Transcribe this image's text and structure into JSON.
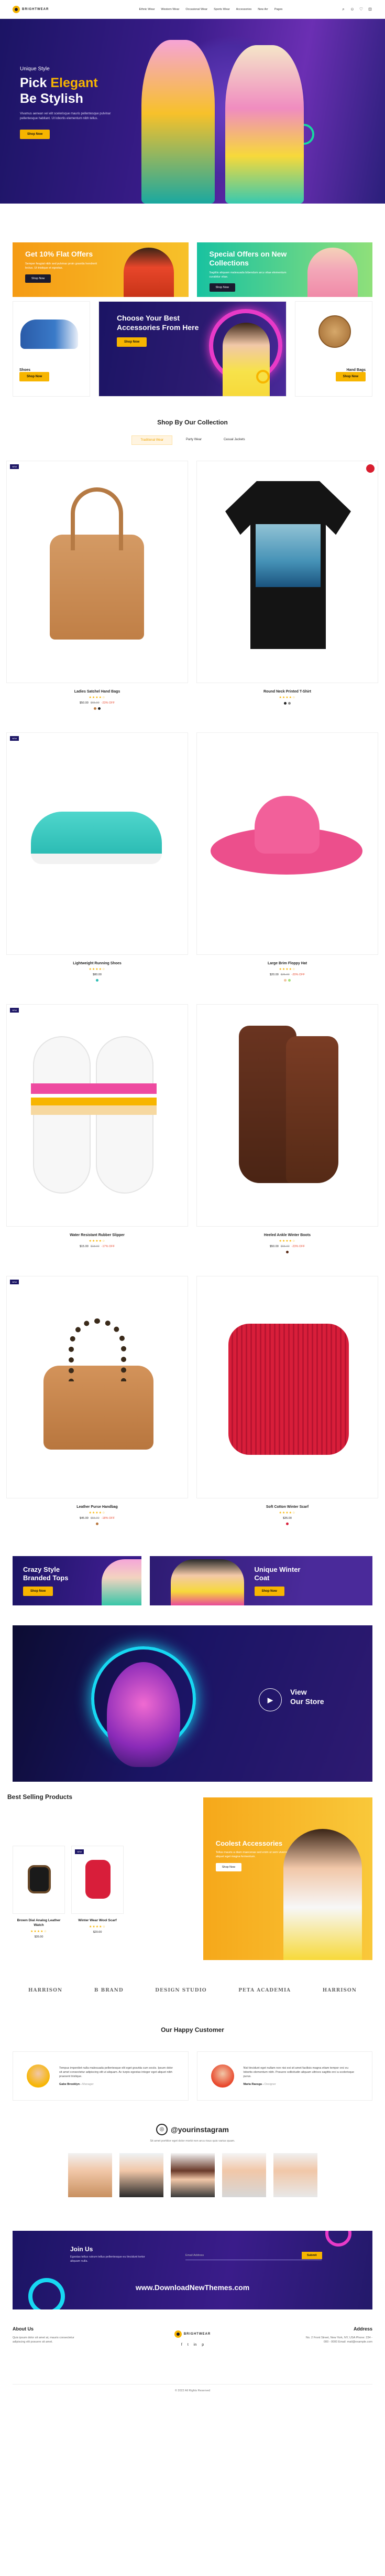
{
  "brand": {
    "name": "BRIGHTWEAR"
  },
  "nav": [
    "Ethnic Wear",
    "Western Wear",
    "Occasional Wear",
    "Sports Wear",
    "Accessories",
    "New Arr",
    "Pages"
  ],
  "hero": {
    "subtitle": "Unique Style",
    "title_line1_a": "Pick ",
    "title_line1_b": "Elegant",
    "title_line2": "Be Stylish",
    "desc": "Vivamus aenean vel elit scelerisque mauris pellentesque pulvinar pellentesque habitant. Ut lobortis elementum nibh tellus.",
    "button": "Shop Now"
  },
  "offers": [
    {
      "title": "Get 10% Flat Offers",
      "desc": "Semper feugiat nibh sed pulvinar proin gravida hendrerit lectus. Ut tristique et egestas.",
      "button": "Shop Now"
    },
    {
      "title": "Special Offers on New Collections",
      "desc": "Sagittis aliquam malesuada bibendum arcu vitae elementum curabitur vitae.",
      "button": "Shop Now"
    }
  ],
  "accessories": {
    "left": {
      "name": "Shoes",
      "button": "Shop Now"
    },
    "center": {
      "title": "Choose Your Best Accessories From Here",
      "button": "Shop Now"
    },
    "right": {
      "name": "Hand Bags",
      "button": "Shop Now"
    }
  },
  "collection": {
    "title": "Shop By Our Collection",
    "tabs": [
      "Traditional Wear",
      "Party Wear",
      "Casual Jackets"
    ]
  },
  "products": [
    {
      "name": "Ladies Satchel Hand Bags",
      "stars": "★★★★☆",
      "price": "$50.00",
      "old": "$65.00",
      "off": "-23% OFF",
      "badge": "NEW"
    },
    {
      "name": "Round Neck Printed T-Shirt",
      "stars": "★★★★☆",
      "price": "",
      "old": "",
      "off": "",
      "badge": ""
    },
    {
      "name": "Lightweight Running Shoes",
      "stars": "★★★★☆",
      "price": "$80.00",
      "old": "",
      "off": "",
      "badge": "NEW"
    },
    {
      "name": "Large Brim Floppy Hat",
      "stars": "★★★★☆",
      "price": "$20.00",
      "old": "$25.00",
      "off": "-20% OFF",
      "badge": ""
    },
    {
      "name": "Water Resistant Rubber Slipper",
      "stars": "★★★★☆",
      "price": "$15.00",
      "old": "$18.00",
      "off": "-17% OFF",
      "badge": "NEW"
    },
    {
      "name": "Heeled Ankle Winter Boots",
      "stars": "★★★★☆",
      "price": "$50.00",
      "old": "$65.00",
      "off": "-23% OFF",
      "badge": ""
    },
    {
      "name": "Leather Purse Handbag",
      "stars": "★★★★☆",
      "price": "$45.00",
      "old": "$55.00",
      "off": "-18% OFF",
      "badge": "NEW"
    },
    {
      "name": "Soft Cotton Winter Scarf",
      "stars": "★★★★☆",
      "price": "$35.00",
      "old": "",
      "off": "",
      "badge": ""
    }
  ],
  "promos": [
    {
      "title": "Crazy Style Branded Tops",
      "button": "Shop Now"
    },
    {
      "title": "Unique Winter Coat",
      "button": "Shop Now"
    }
  ],
  "video": {
    "text_line1": "View",
    "text_line2": "Our Store"
  },
  "best": {
    "title": "Best Selling Products",
    "items": [
      {
        "name": "Brown Dial Analog Leather Watch",
        "stars": "★★★★☆",
        "price": "$35.00"
      },
      {
        "name": "Winter Wear Wool Scarf",
        "stars": "★★★★☆",
        "price": "$20.00"
      }
    ],
    "promo": {
      "title": "Coolest Accessories",
      "desc": "Tellus mauris a diam maecenas sed enim ut sem viverra aliquet eget magna fermentum.",
      "button": "Shop Now"
    }
  },
  "brands": [
    "HARRISON",
    "B BRAND",
    "DESIGN STUDIO",
    "PETA ACADEMIA",
    "HARRISON"
  ],
  "testimonials": {
    "title": "Our Happy Customer",
    "items": [
      {
        "text": "Tempus imperdiet nulla malesuada pellentesque elit eget gravida cum sociis. Ipsum dolor sit amet consectetur adipiscing elit ut aliquam. Ac turpis egestas integer eget aliquet nibh praesent tristique.",
        "name": "Gabe Brooklyn",
        "role": "Manager"
      },
      {
        "text": "Nisl tincidunt eget nullam non nisi est sit amet facilisis magna etiam tempor orci eu lobortis elementum nibh. Posuere sollicitudin aliquam ultrices sagittis orci a scelerisque purus.",
        "name": "Maria Raesga",
        "role": "Designer"
      }
    ]
  },
  "instagram": {
    "handle": "@yourinstagram",
    "desc": "Sit amet porttitor eget dolor morbi non arcu risus quis varius quam."
  },
  "newsletter": {
    "title": "Join Us",
    "desc": "Egestas tellus rutrum tellus pellentesque eu tincidunt tortor aliquam nulla.",
    "placeholder": "Email Address",
    "button": "Submit",
    "url": "www.DownloadNewThemes.com"
  },
  "footer": {
    "about_title": "About Us",
    "about_text": "Quis ipsum dolor sit amet at, mauris consectetur adipiscing elit posuere sit amet.",
    "address_title": "Address",
    "address_text": "No. 2 Front Street, New York, NY, USA Phone: 234 - 000 - 0000 Email: mail@example.com",
    "social": [
      "f",
      "t",
      "in",
      "p"
    ],
    "copyright": "© 2022 All Rights Reserved"
  },
  "colors": {
    "accent": "#f7b500",
    "primary": "#1b1464"
  }
}
